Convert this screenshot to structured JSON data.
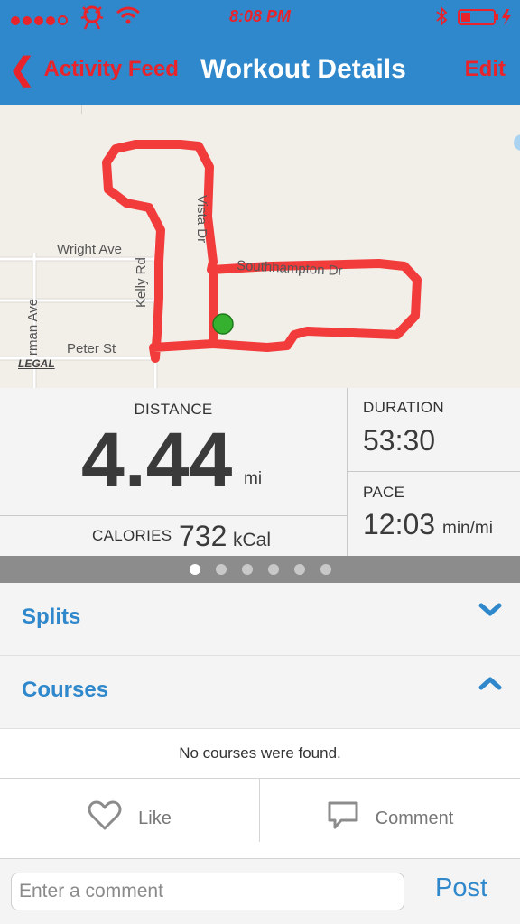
{
  "status": {
    "time": "8:08 PM"
  },
  "nav": {
    "back_label": "Activity Feed",
    "title": "Workout Details",
    "edit_label": "Edit"
  },
  "map": {
    "streets": [
      "Wright Ave",
      "Kelly Rd",
      "Vista Dr",
      "Southhampton Dr",
      "Peter St",
      "rman Ave"
    ],
    "legal_label": "LEGAL",
    "route_color": "#f23b3b",
    "start_marker_color": "#35b12f"
  },
  "stats": {
    "distance": {
      "label": "DISTANCE",
      "value": "4.44",
      "unit": "mi"
    },
    "calories": {
      "label": "CALORIES",
      "value": "732",
      "unit": "kCal"
    },
    "duration": {
      "label": "DURATION",
      "value": "53:30"
    },
    "pace": {
      "label": "PACE",
      "value": "12:03",
      "unit": "min/mi"
    }
  },
  "pager": {
    "count": 6,
    "active_index": 0
  },
  "sections": {
    "splits": {
      "title": "Splits",
      "state": "collapsed"
    },
    "courses": {
      "title": "Courses",
      "state": "expanded",
      "empty_text": "No courses were found."
    }
  },
  "actions": {
    "like_label": "Like",
    "comment_label": "Comment"
  },
  "comment": {
    "placeholder": "Enter a comment",
    "post_label": "Post"
  },
  "colors": {
    "accent_blue": "#2f88cb",
    "nav_red": "#e8232b"
  }
}
